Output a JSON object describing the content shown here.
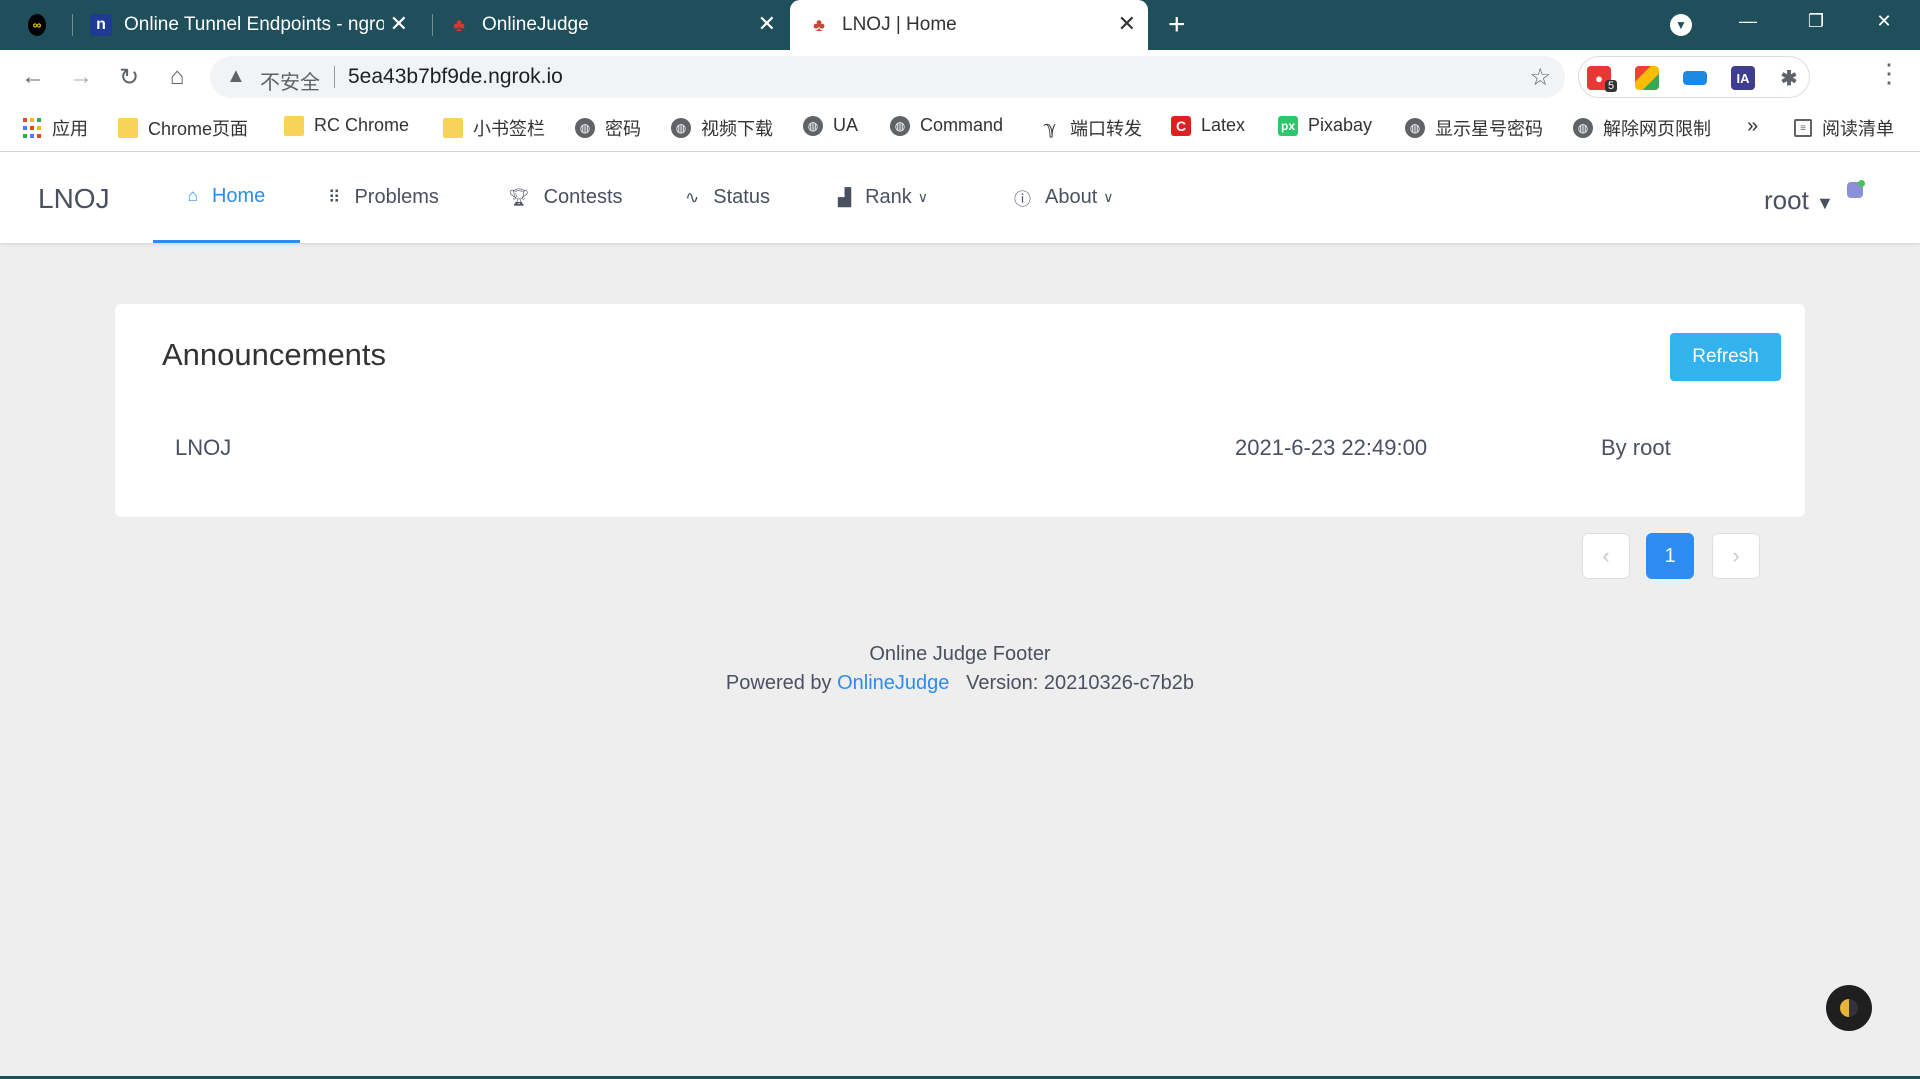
{
  "browser": {
    "tabs": [
      {
        "title": "Online Tunnel Endpoints - ngrok"
      },
      {
        "title": "OnlineJudge"
      },
      {
        "title": "LNOJ | Home",
        "active": true
      }
    ],
    "new_tab": "+",
    "close": "✕",
    "window_controls": {
      "minimize": "—",
      "restore": "❐",
      "close": "✕"
    },
    "address": {
      "security_label": "不安全",
      "url": "5ea43b7bf9de.ngrok.io"
    },
    "extension_badge": "5",
    "bookmarks": [
      {
        "label": "应用",
        "icon": "apps-icon"
      },
      {
        "label": "Chrome页面",
        "icon": "folder-icon"
      },
      {
        "label": "RC Chrome",
        "icon": "folder-icon"
      },
      {
        "label": "小书签栏",
        "icon": "folder-icon"
      },
      {
        "label": "密码",
        "icon": "globe-icon"
      },
      {
        "label": "视频下载",
        "icon": "globe-icon"
      },
      {
        "label": "UA",
        "icon": "globe-icon"
      },
      {
        "label": "Command",
        "icon": "globe-icon"
      },
      {
        "label": "端口转发",
        "icon": "tunnel-icon"
      },
      {
        "label": "Latex",
        "icon": "latex-icon"
      },
      {
        "label": "Pixabay",
        "icon": "pixabay-icon"
      },
      {
        "label": "显示星号密码",
        "icon": "globe-icon"
      },
      {
        "label": "解除网页限制",
        "icon": "globe-icon"
      }
    ],
    "bookmarks_overflow": "»",
    "reading_list": "阅读清单"
  },
  "oj": {
    "logo": "LNOJ",
    "nav": [
      {
        "label": "Home",
        "icon": "home-icon",
        "active": true
      },
      {
        "label": "Problems",
        "icon": "grid-icon"
      },
      {
        "label": "Contests",
        "icon": "trophy-icon"
      },
      {
        "label": "Status",
        "icon": "pulse-icon"
      },
      {
        "label": "Rank",
        "icon": "bar-chart-icon",
        "dropdown": true
      },
      {
        "label": "About",
        "icon": "info-icon",
        "dropdown": true
      }
    ],
    "user": "root"
  },
  "announcements": {
    "title": "Announcements",
    "refresh_label": "Refresh",
    "items": [
      {
        "title": "LNOJ",
        "time": "2021-6-23 22:49:00",
        "author": "By root"
      }
    ]
  },
  "pagination": {
    "prev": "‹",
    "current": "1",
    "next": "›"
  },
  "footer": {
    "line1": "Online Judge Footer",
    "powered_by": "Powered by",
    "link": "OnlineJudge",
    "version": "Version: 20210326-c7b2b"
  },
  "colors": {
    "accent": "#2d8cf0",
    "refresh": "#33b3ee",
    "tabstrip": "#1e4f5a",
    "page_bg": "#eeeeee"
  }
}
